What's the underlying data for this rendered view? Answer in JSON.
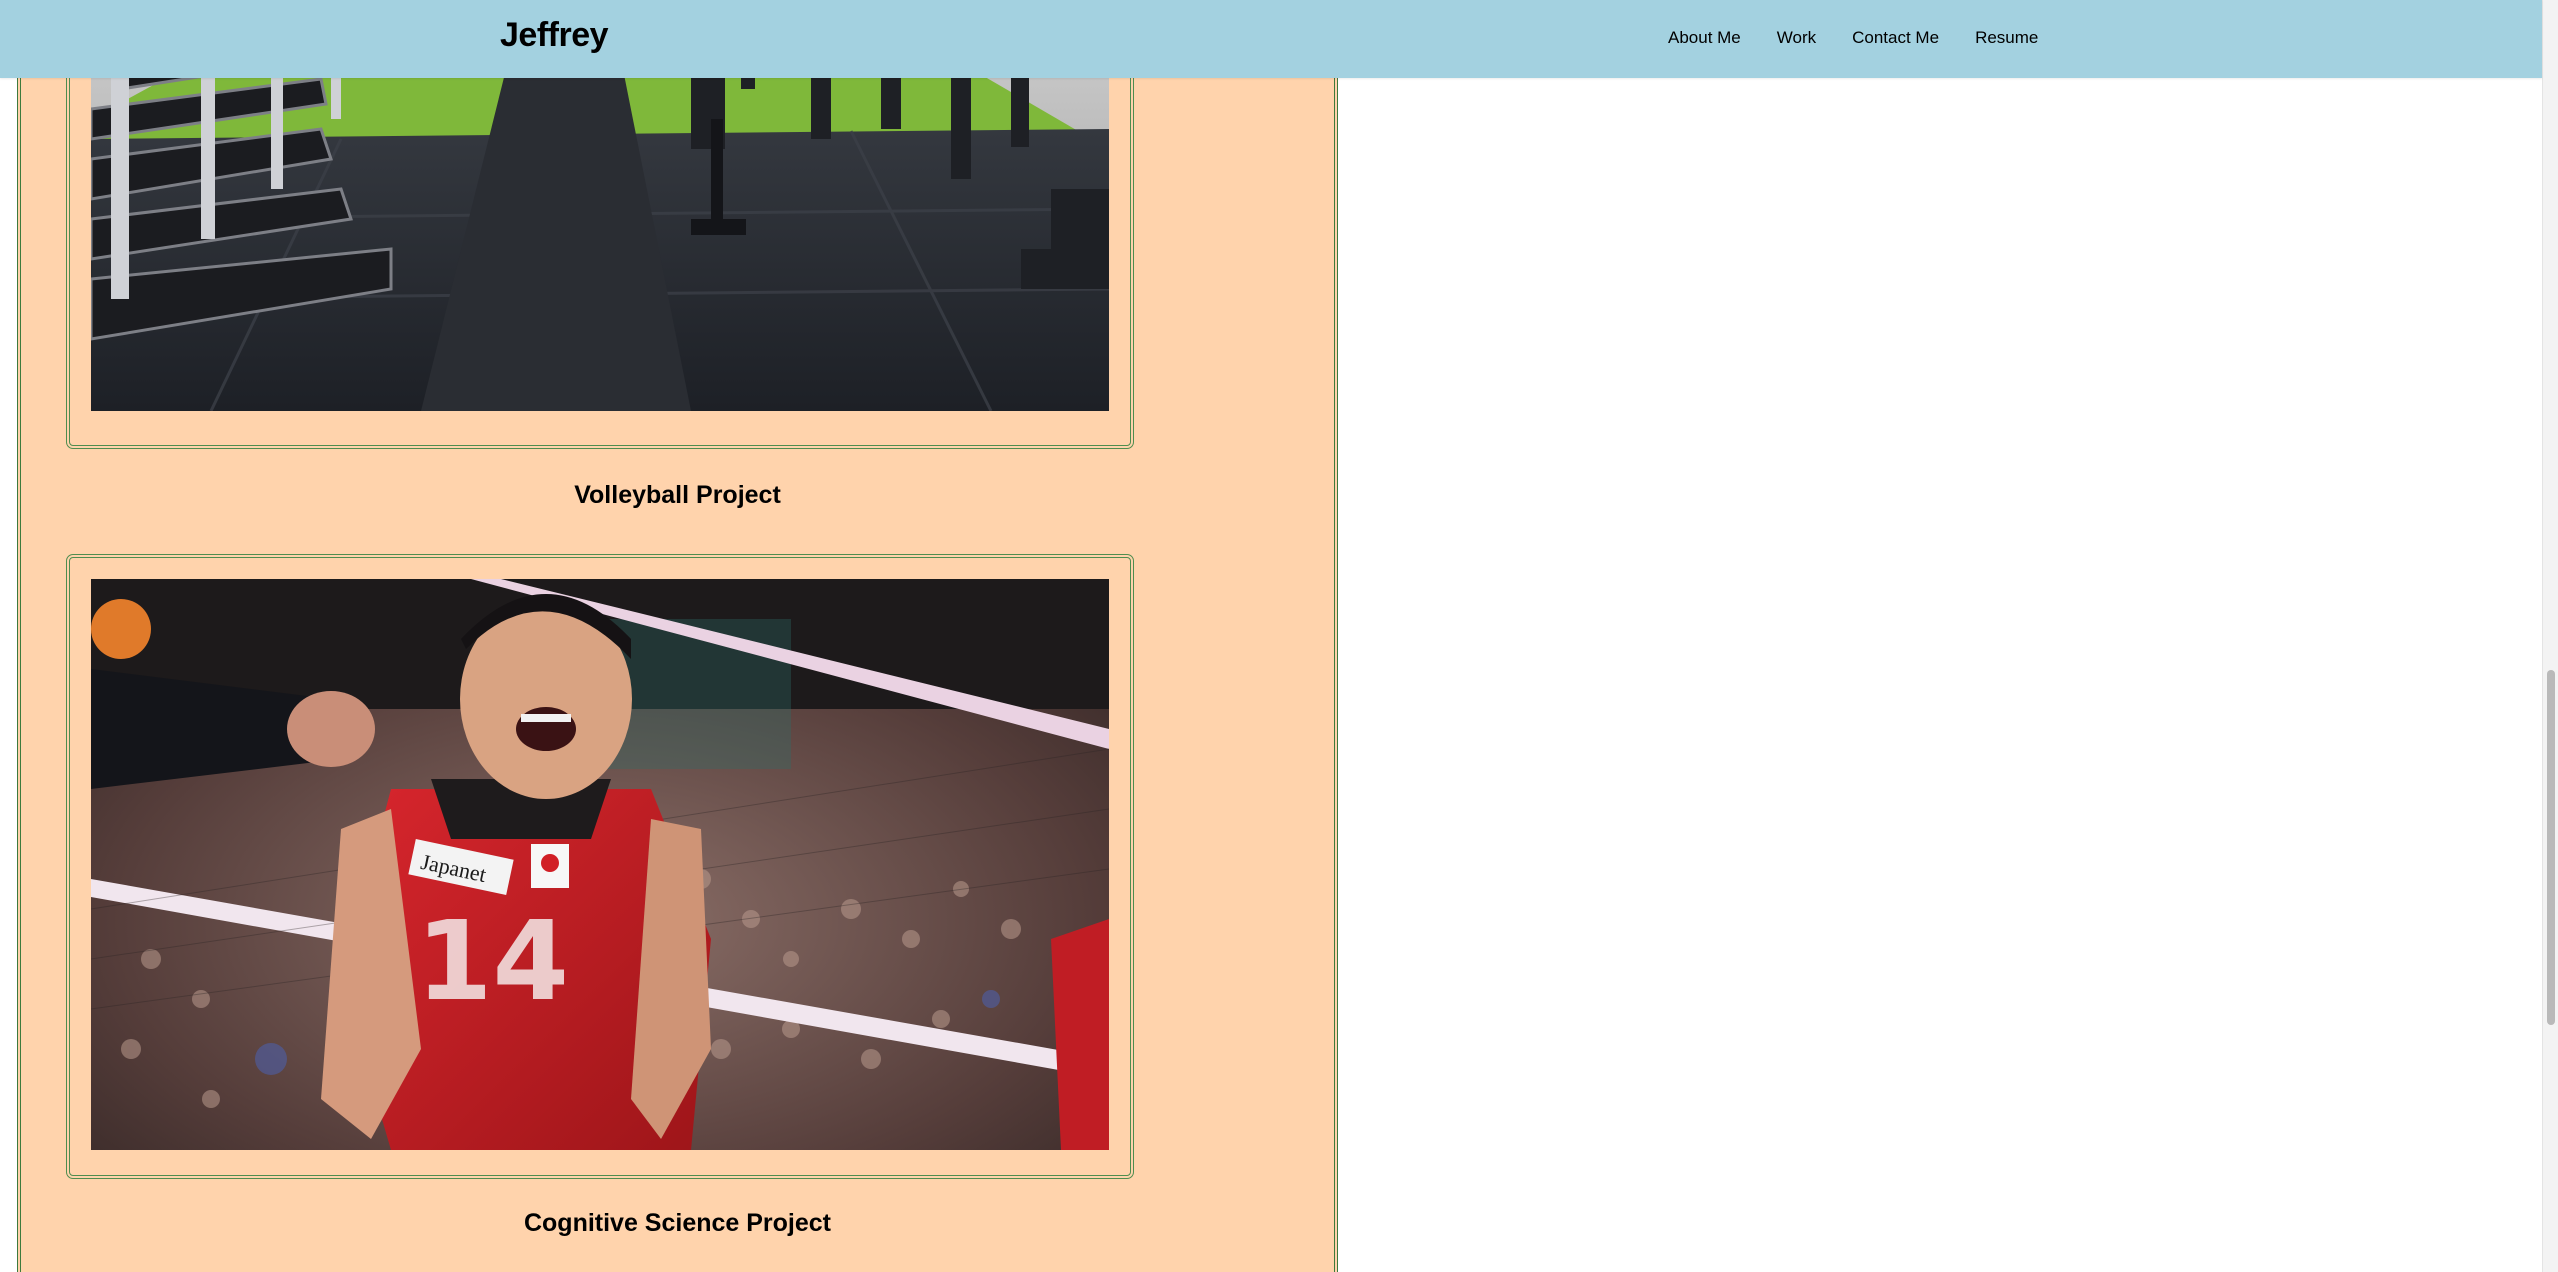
{
  "header": {
    "brand": "Jeffrey",
    "nav": [
      "About Me",
      "Work",
      "Contact Me",
      "Resume"
    ]
  },
  "work": {
    "projects": [
      {
        "title": "",
        "image": "gym-photo"
      },
      {
        "title": "Volleyball Project",
        "image": "volleyball-photo"
      },
      {
        "title": "Cognitive Science Project",
        "image": ""
      }
    ]
  },
  "colors": {
    "header_bg": "#a3d1e0",
    "work_bg": "#ffd3ac",
    "frame_border": "#4f8d4f"
  }
}
